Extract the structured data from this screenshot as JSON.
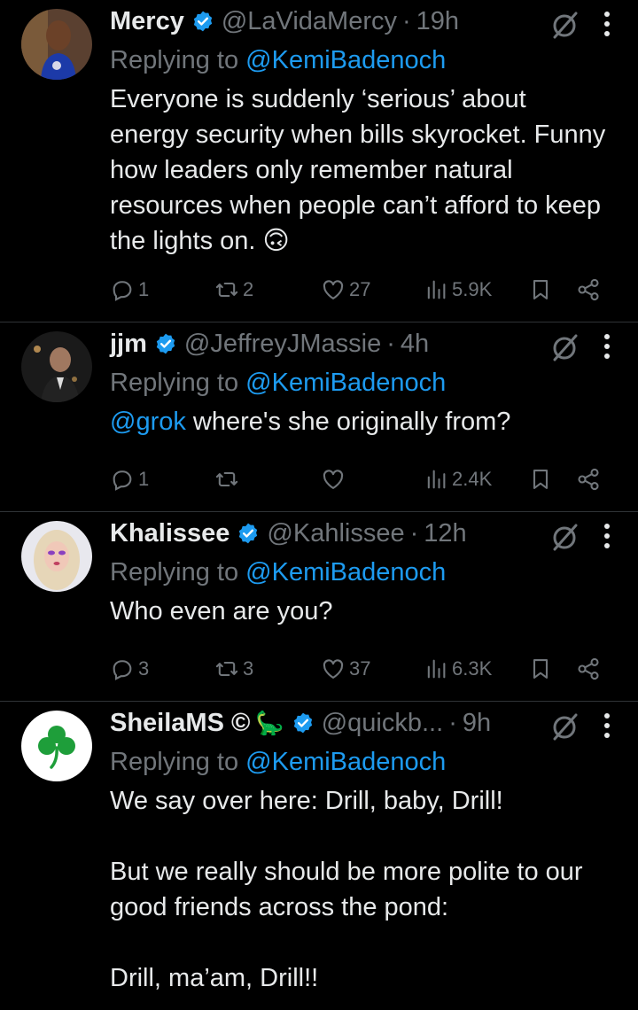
{
  "tweets": [
    {
      "name": "Mercy",
      "handle": "@LaVidaMercy",
      "time": "19h",
      "replying_label": "Replying to",
      "replying_to": "@KemiBadenoch",
      "text": "Everyone is suddenly ‘serious’ about energy security when bills skyrocket. Funny how leaders only remember natural resources when people can’t afford to keep the lights on. 🙃",
      "replies": "1",
      "reposts": "2",
      "likes": "27",
      "views": "5.9K"
    },
    {
      "name": "jjm",
      "handle": "@JeffreyJMassie",
      "time": "4h",
      "replying_label": "Replying to",
      "replying_to": "@KemiBadenoch",
      "text_mention": "@grok",
      "text": " where's she originally from?",
      "replies": "1",
      "reposts": "",
      "likes": "",
      "views": "2.4K"
    },
    {
      "name": "Khalissee",
      "handle": "@Kahlissee",
      "time": "12h",
      "replying_label": "Replying to",
      "replying_to": "@KemiBadenoch",
      "text": "Who even are you?",
      "replies": "3",
      "reposts": "3",
      "likes": "37",
      "views": "6.3K"
    },
    {
      "name": "SheilaMS ©",
      "name_emoji": "🦕",
      "handle": "@quickb...",
      "time": "9h",
      "replying_label": "Replying to",
      "replying_to": "@KemiBadenoch",
      "text": "We say over here: Drill, baby, Drill!\n\nBut we really should be more polite to our good friends across the pond:\n\nDrill, ma’am, Drill!!"
    }
  ],
  "separator": "·",
  "colors": {
    "background": "#000000",
    "text": "#e7e9ea",
    "secondary": "#71767b",
    "accent": "#1d9bf0",
    "divider": "#2f3336"
  },
  "icons": {
    "verified": "verified-badge-icon",
    "grok": "grok-icon",
    "more": "more-dots-icon",
    "reply": "reply-icon",
    "repost": "repost-icon",
    "like": "heart-icon",
    "views": "views-icon",
    "bookmark": "bookmark-icon",
    "share": "share-icon"
  }
}
